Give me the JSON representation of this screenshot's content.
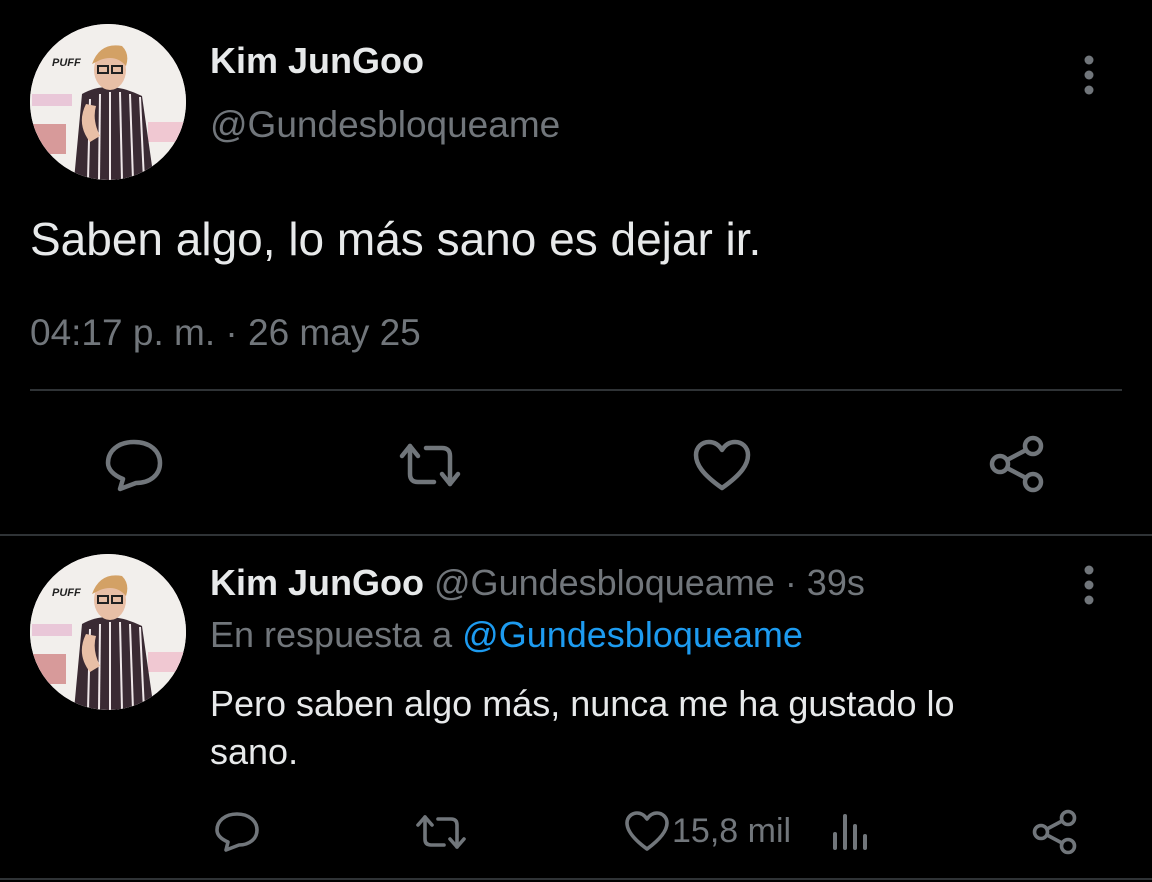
{
  "main_tweet": {
    "author_name": "Kim JunGoo",
    "handle": "@Gundesbloqueame",
    "text": "Saben algo, lo más sano es dejar ir.",
    "timestamp": "04:17 p. m. · 26 may 25",
    "avatar_caption": "PUFF",
    "actions": [
      "reply-icon",
      "retweet-icon",
      "like-icon",
      "share-icon"
    ]
  },
  "reply_tweet": {
    "author_name": "Kim JunGoo",
    "handle": "@Gundesbloqueame",
    "age": "· 39s",
    "replying_to_prefix": "En respuesta a",
    "replying_to_handle": "@Gundesbloqueame",
    "text_line1": "Pero saben algo más, nunca me ha gustado lo",
    "text_line2": "sano.",
    "like_count": "15,8 mil",
    "avatar_caption": "PUFF",
    "actions": [
      "reply-icon",
      "retweet-icon",
      "like-icon",
      "views-icon",
      "share-icon"
    ]
  },
  "colors": {
    "background": "#000000",
    "text": "#e7e9ea",
    "muted": "#71767b",
    "link": "#1d9bf0",
    "divider": "#2f3336"
  }
}
